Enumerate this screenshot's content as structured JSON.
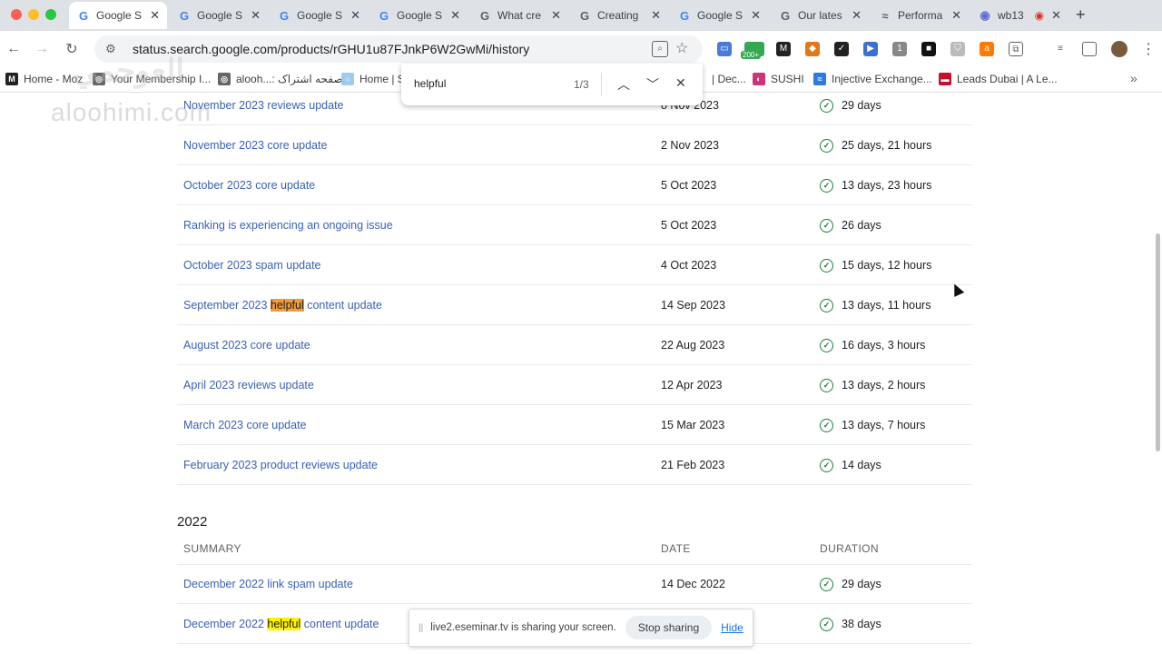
{
  "tabs": [
    {
      "title": "Google S",
      "favicon": "G",
      "active": true
    },
    {
      "title": "Google S",
      "favicon": "G"
    },
    {
      "title": "Google S",
      "favicon": "G"
    },
    {
      "title": "Google S",
      "favicon": "G"
    },
    {
      "title": "What cre",
      "favicon": "G"
    },
    {
      "title": "Creating",
      "favicon": "G"
    },
    {
      "title": "Google S",
      "favicon": "G"
    },
    {
      "title": "Our lates",
      "favicon": "G"
    },
    {
      "title": "Performa",
      "favicon": "≈"
    },
    {
      "title": "wb13",
      "favicon": "◉"
    }
  ],
  "toolbar": {
    "url": "status.search.google.com/products/rGHU1u87FJnkP6W2GwMi/history",
    "extension_badge": "200+"
  },
  "bookmarks": [
    {
      "label": "Home - Moz",
      "icon": "M"
    },
    {
      "label": "Your Membership I...",
      "icon": "◎"
    },
    {
      "label": "alooh...: صفحه اشتراک",
      "icon": "◎"
    },
    {
      "label": "Home | S",
      "icon": "○"
    },
    {
      "label": "| Dec...",
      "icon": ""
    },
    {
      "label": "SUSHI",
      "icon": "◐"
    },
    {
      "label": "Injective Exchange...",
      "icon": "≈"
    },
    {
      "label": "Leads Dubai | A Le...",
      "icon": "▬"
    }
  ],
  "watermark": {
    "text": "aloohimi.com",
    "arabic": "العوحمي"
  },
  "find_bar": {
    "query": "helpful",
    "count": "1/3"
  },
  "updates_2023": [
    {
      "pre": "November 2023 reviews update",
      "hl": "",
      "post": "",
      "date": "8 Nov 2023",
      "duration": "29 days"
    },
    {
      "pre": "November 2023 core update",
      "hl": "",
      "post": "",
      "date": "2 Nov 2023",
      "duration": "25 days, 21 hours"
    },
    {
      "pre": "October 2023 core update",
      "hl": "",
      "post": "",
      "date": "5 Oct 2023",
      "duration": "13 days, 23 hours"
    },
    {
      "pre": "Ranking is experiencing an ongoing issue",
      "hl": "",
      "post": "",
      "date": "5 Oct 2023",
      "duration": "26 days"
    },
    {
      "pre": "October 2023 spam update",
      "hl": "",
      "post": "",
      "date": "4 Oct 2023",
      "duration": "15 days, 12 hours"
    },
    {
      "pre": "September 2023 ",
      "hl": "helpful",
      "post": " content update",
      "date": "14 Sep 2023",
      "duration": "13 days, 11 hours"
    },
    {
      "pre": "August 2023 core update",
      "hl": "",
      "post": "",
      "date": "22 Aug 2023",
      "duration": "16 days, 3 hours"
    },
    {
      "pre": "April 2023 reviews update",
      "hl": "",
      "post": "",
      "date": "12 Apr 2023",
      "duration": "13 days, 2 hours"
    },
    {
      "pre": "March 2023 core update",
      "hl": "",
      "post": "",
      "date": "15 Mar 2023",
      "duration": "13 days, 7 hours"
    },
    {
      "pre": "February 2023 product reviews update",
      "hl": "",
      "post": "",
      "date": "21 Feb 2023",
      "duration": "14 days"
    }
  ],
  "section_2022": {
    "year": "2022",
    "headers": {
      "summary": "SUMMARY",
      "date": "DATE",
      "duration": "DURATION"
    },
    "rows": [
      {
        "pre": "December 2022 link spam update",
        "hl": "",
        "post": "",
        "date": "14 Dec 2022",
        "duration": "29 days"
      },
      {
        "pre": "December 2022 ",
        "hl": "helpful",
        "post": " content update",
        "date": "",
        "duration": "38 days"
      }
    ]
  },
  "share_notice": {
    "text": "live2.eseminar.tv is sharing your screen.",
    "stop_label": "Stop sharing",
    "hide_label": "Hide"
  }
}
